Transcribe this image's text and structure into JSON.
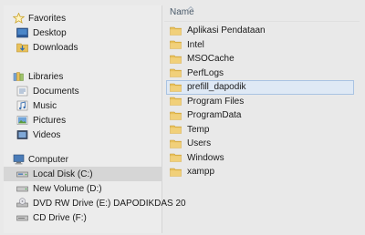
{
  "nav": {
    "favorites": {
      "label": "Favorites",
      "items": [
        {
          "label": "Desktop",
          "icon": "desktop-icon"
        },
        {
          "label": "Downloads",
          "icon": "downloads-icon"
        }
      ]
    },
    "libraries": {
      "label": "Libraries",
      "items": [
        {
          "label": "Documents",
          "icon": "documents-icon"
        },
        {
          "label": "Music",
          "icon": "music-icon"
        },
        {
          "label": "Pictures",
          "icon": "pictures-icon"
        },
        {
          "label": "Videos",
          "icon": "videos-icon"
        }
      ]
    },
    "computer": {
      "label": "Computer",
      "items": [
        {
          "label": "Local Disk (C:)",
          "icon": "hard-disk-icon",
          "selected": true
        },
        {
          "label": "New Volume (D:)",
          "icon": "hard-disk-icon"
        },
        {
          "label": "DVD RW Drive (E:) DAPODIKDAS 20",
          "icon": "dvd-drive-icon"
        },
        {
          "label": "CD Drive (F:)",
          "icon": "cd-drive-icon"
        }
      ]
    }
  },
  "files": {
    "column_name": "Name",
    "items": [
      {
        "label": "Aplikasi Pendataan",
        "type": "folder"
      },
      {
        "label": "Intel",
        "type": "folder"
      },
      {
        "label": "MSOCache",
        "type": "folder"
      },
      {
        "label": "PerfLogs",
        "type": "folder"
      },
      {
        "label": "prefill_dapodik",
        "type": "folder",
        "selected": true
      },
      {
        "label": "Program Files",
        "type": "folder"
      },
      {
        "label": "ProgramData",
        "type": "folder"
      },
      {
        "label": "Temp",
        "type": "folder"
      },
      {
        "label": "Users",
        "type": "folder"
      },
      {
        "label": "Windows",
        "type": "folder"
      },
      {
        "label": "xampp",
        "type": "folder"
      }
    ]
  },
  "colors": {
    "folder": "#e8c15a",
    "folder_dark": "#c99a2e",
    "selected_row": "#dfe9f5",
    "selected_border": "#a9c3e2",
    "favorites_star": "#f2c230"
  }
}
